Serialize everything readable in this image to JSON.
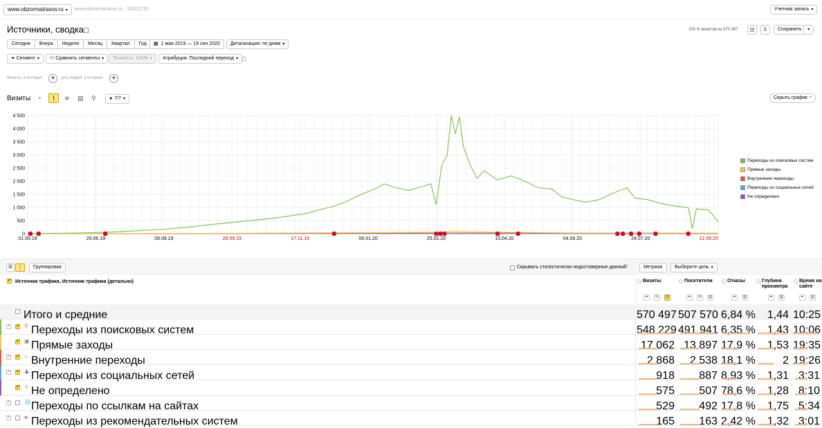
{
  "top": {
    "site": "www.obzormatrasov.ru",
    "site_meta": "www.obzormatrasov.ru · 50921720",
    "account": "Учетная запись"
  },
  "header": {
    "title": "Источники, сводка",
    "visits_share": "100 % визитов из 570 497",
    "save": "Сохранить"
  },
  "period": {
    "tabs": [
      "Сегодня",
      "Вчера",
      "Неделя",
      "Месяц",
      "Квартал",
      "Год"
    ],
    "range": "1 мая 2019 — 19 сен 2020",
    "detail": "Детализация: по дням"
  },
  "filters": {
    "segment": "Сегмент",
    "compare": "Сравнить сегменты",
    "accuracy": "Точность: 100%",
    "attribution": "Атрибуция: Последний переход",
    "visits_which": "Визиты, в которых",
    "people_which": "для людей, у которых"
  },
  "chart_header": {
    "title": "Визиты",
    "series_count": "7/7",
    "hide": "Скрыть график"
  },
  "chart_data": {
    "type": "line",
    "x_tick_labels": [
      "01.05.19",
      "20.06.19",
      "09.08.19",
      "28.09.19",
      "17.11.19",
      "06.01.20",
      "25.02.20",
      "15.04.20",
      "04.06.20",
      "24.07.20",
      "12.09.20"
    ],
    "x_tick_colors": [
      "#000",
      "#000",
      "#000",
      "#c00",
      "#c00",
      "#000",
      "#000",
      "#000",
      "#000",
      "#000",
      "#c00"
    ],
    "y_tick_labels": [
      "0",
      "500",
      "1 000",
      "1 500",
      "2 000",
      "2 500",
      "3 000",
      "3 500",
      "4 000",
      "4 500"
    ],
    "ylim": [
      0,
      4500
    ],
    "xlim_days": [
      0,
      507
    ],
    "grid": true,
    "legend_position": "right",
    "series": [
      {
        "name": "Переходы из поисковых систем",
        "color": "#7cbf4a",
        "points": [
          [
            0,
            0
          ],
          [
            20,
            15
          ],
          [
            40,
            30
          ],
          [
            60,
            60
          ],
          [
            80,
            110
          ],
          [
            100,
            170
          ],
          [
            120,
            260
          ],
          [
            140,
            380
          ],
          [
            160,
            480
          ],
          [
            175,
            560
          ],
          [
            185,
            620
          ],
          [
            195,
            700
          ],
          [
            205,
            780
          ],
          [
            215,
            920
          ],
          [
            225,
            1050
          ],
          [
            235,
            1250
          ],
          [
            245,
            1500
          ],
          [
            255,
            1700
          ],
          [
            262,
            1900
          ],
          [
            270,
            1750
          ],
          [
            280,
            1650
          ],
          [
            290,
            1800
          ],
          [
            296,
            1900
          ],
          [
            300,
            1100
          ],
          [
            304,
            2600
          ],
          [
            308,
            3000
          ],
          [
            311,
            4500
          ],
          [
            314,
            3800
          ],
          [
            317,
            4450
          ],
          [
            320,
            3300
          ],
          [
            325,
            2600
          ],
          [
            330,
            2100
          ],
          [
            335,
            2400
          ],
          [
            345,
            2050
          ],
          [
            355,
            2200
          ],
          [
            365,
            2000
          ],
          [
            375,
            1750
          ],
          [
            385,
            1700
          ],
          [
            392,
            1400
          ],
          [
            400,
            1300
          ],
          [
            410,
            1200
          ],
          [
            420,
            1300
          ],
          [
            430,
            1550
          ],
          [
            440,
            1750
          ],
          [
            446,
            1350
          ],
          [
            455,
            1300
          ],
          [
            465,
            1150
          ],
          [
            475,
            1050
          ],
          [
            485,
            1000
          ],
          [
            488,
            200
          ],
          [
            491,
            950
          ],
          [
            500,
            900
          ],
          [
            507,
            450
          ]
        ]
      },
      {
        "name": "Прямые заходы",
        "color": "#f5c542",
        "points": [
          [
            0,
            0
          ],
          [
            150,
            15
          ],
          [
            250,
            40
          ],
          [
            300,
            60
          ],
          [
            315,
            90
          ],
          [
            340,
            60
          ],
          [
            400,
            30
          ],
          [
            507,
            20
          ]
        ]
      },
      {
        "name": "Внутренние переходы",
        "color": "#e8533f",
        "points": [
          [
            0,
            0
          ],
          [
            300,
            20
          ],
          [
            315,
            30
          ],
          [
            507,
            10
          ]
        ]
      },
      {
        "name": "Переходы из социальных сетей",
        "color": "#5aa5e0",
        "points": [
          [
            0,
            0
          ],
          [
            507,
            5
          ]
        ]
      },
      {
        "name": "Не определено",
        "color": "#9a4fc4",
        "points": [
          [
            0,
            0
          ],
          [
            507,
            3
          ]
        ]
      }
    ],
    "annotation_markers_days": [
      2,
      8,
      57,
      225,
      300,
      303,
      306,
      345,
      360,
      433,
      437,
      443,
      449,
      461,
      485
    ]
  },
  "table": {
    "view_group": "Группировки",
    "hide_unreliable": "Скрывать статистически недостоверные данные",
    "metrics_btn": "Метрики",
    "goal_btn": "Выберите цель",
    "dimension_header": "Источник трафика, Источник трафика (детально)",
    "columns": [
      "Визиты",
      "Посетители",
      "Отказы",
      "Глубина просмотра",
      "Время на сайте"
    ],
    "totals": {
      "label": "Итого и средние",
      "values": [
        "570 497",
        "507 570",
        "6,84 %",
        "1,44",
        "10:25"
      ]
    },
    "rows": [
      {
        "label": "Переходы из поисковых систем",
        "icon": "search-icon",
        "checked": true,
        "values": [
          "548 229",
          "491 941",
          "6,35 %",
          "1,43",
          "10:06"
        ],
        "color": "#7cbf4a"
      },
      {
        "label": "Прямые заходы",
        "icon": "direct-icon",
        "checked": true,
        "values": [
          "17 062",
          "13 897",
          "17,9 %",
          "1,53",
          "19:35"
        ],
        "color": "#f5c542"
      },
      {
        "label": "Внутренние переходы",
        "icon": "home-icon",
        "checked": true,
        "values": [
          "2 868",
          "2 538",
          "18,1 %",
          "2",
          "19:26"
        ],
        "color": "#e8533f"
      },
      {
        "label": "Переходы из социальных сетей",
        "icon": "social-icon",
        "checked": true,
        "values": [
          "918",
          "887",
          "8,93 %",
          "1,31",
          "3:31"
        ],
        "color": "#5aa5e0"
      },
      {
        "label": "Не определено",
        "icon": "undefined-icon",
        "checked": true,
        "values": [
          "575",
          "507",
          "78,6 %",
          "1,28",
          "8:10"
        ],
        "color": "#9a4fc4"
      },
      {
        "label": "Переходы по ссылкам на сайтах",
        "icon": "link-icon",
        "checked": false,
        "values": [
          "529",
          "492",
          "17,8 %",
          "1,75",
          "5:34"
        ],
        "color": ""
      },
      {
        "label": "Переходы из рекомендательных систем",
        "icon": "recommend-icon",
        "checked": false,
        "values": [
          "165",
          "163",
          "2,42 %",
          "1,32",
          "3:01"
        ],
        "color": ""
      }
    ]
  }
}
